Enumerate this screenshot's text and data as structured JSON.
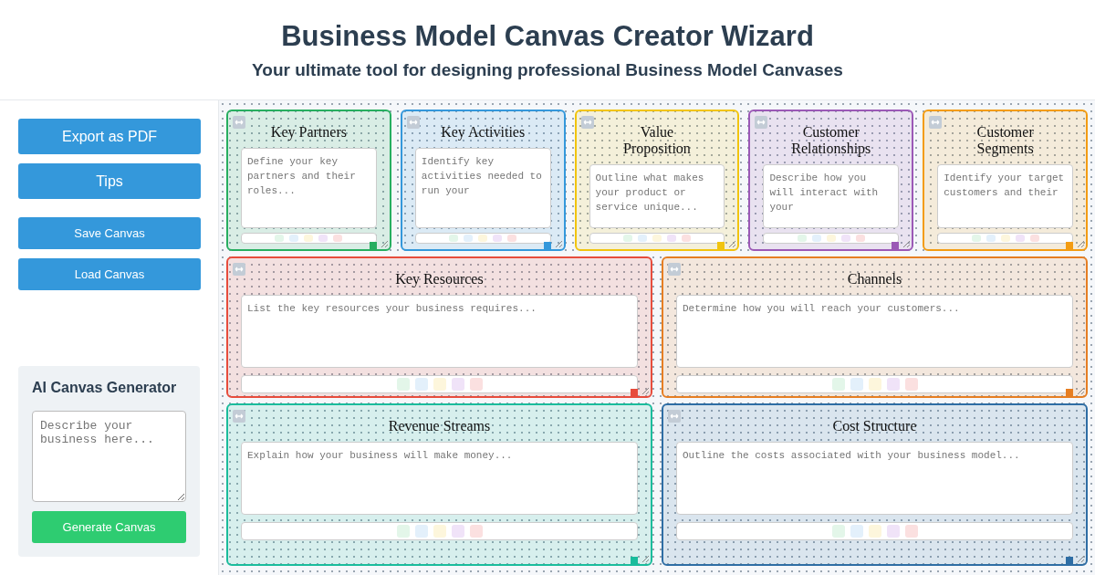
{
  "header": {
    "title": "Business Model Canvas Creator Wizard",
    "subtitle": "Your ultimate tool for designing professional Business Model Canvases"
  },
  "sidebar": {
    "buttons": [
      {
        "label": "Export as PDF",
        "kind": "large"
      },
      {
        "label": "Tips",
        "kind": "large"
      },
      {
        "label": "Save Canvas",
        "kind": "small"
      },
      {
        "label": "Load Canvas",
        "kind": "small"
      }
    ],
    "ai_generator": {
      "title": "AI Canvas Generator",
      "placeholder": "Describe your business here...",
      "button": "Generate Canvas"
    }
  },
  "canvas": {
    "blocks": [
      {
        "title": "Key Partners",
        "placeholder": "Define your key partners and their roles...",
        "color": "#27ae60",
        "kind": "narrow"
      },
      {
        "title": "Key Activities",
        "placeholder": "Identify key activities needed to run your",
        "color": "#3498db",
        "kind": "narrow"
      },
      {
        "title": "Value Proposition",
        "placeholder": "Outline what makes your product or service unique...",
        "color": "#f1c40f",
        "kind": "narrow"
      },
      {
        "title": "Customer Relationships",
        "placeholder": "Describe how you will interact with your",
        "color": "#9b59b6",
        "kind": "narrow"
      },
      {
        "title": "Customer Segments",
        "placeholder": "Identify your target customers and their",
        "color": "#f39c12",
        "kind": "narrow"
      },
      {
        "title": "Key Resources",
        "placeholder": "List the key resources your business requires...",
        "color": "#e74c3c",
        "kind": "wide"
      },
      {
        "title": "Channels",
        "placeholder": "Determine how you will reach your customers...",
        "color": "#e67e22",
        "kind": "wide"
      },
      {
        "title": "Revenue Streams",
        "placeholder": "Explain how your business will make money...",
        "color": "#1abc9c",
        "kind": "wide"
      },
      {
        "title": "Cost Structure",
        "placeholder": "Outline the costs associated with your business model...",
        "color": "#2e6da4",
        "kind": "wide"
      }
    ]
  }
}
